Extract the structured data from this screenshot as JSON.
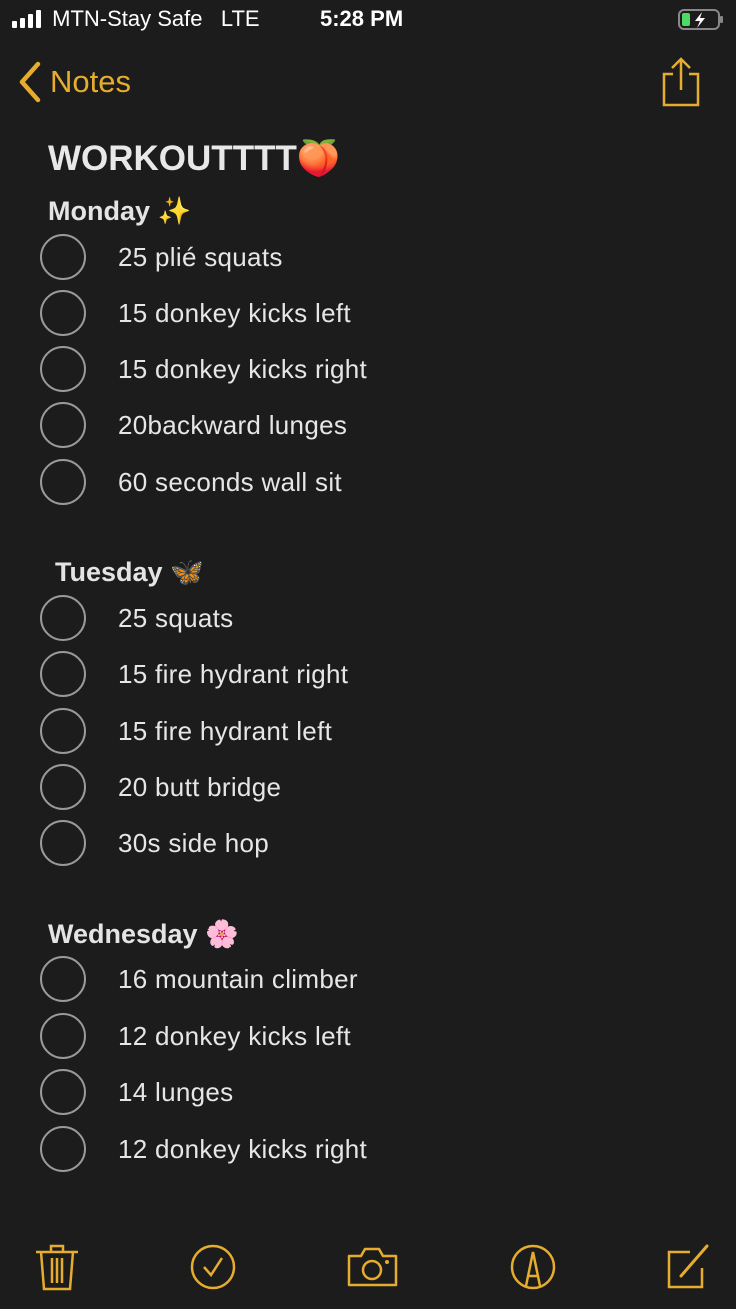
{
  "status_bar": {
    "carrier": "MTN-Stay Safe",
    "network": "LTE",
    "time": "5:28 PM",
    "battery": "charging"
  },
  "nav": {
    "back_label": "Notes"
  },
  "note": {
    "title": "WORKOUTTTT",
    "title_emoji": "🍑",
    "sections": [
      {
        "day": "Monday",
        "emoji": "✨",
        "items": [
          {
            "text": "25 plié squats",
            "checked": false
          },
          {
            "text": "15 donkey kicks left",
            "checked": false
          },
          {
            "text": "15 donkey kicks right",
            "checked": false
          },
          {
            "text": "20backward lunges",
            "checked": false
          },
          {
            "text": "60 seconds wall sit",
            "checked": false
          }
        ]
      },
      {
        "day": "Tuesday",
        "emoji": "🦋",
        "items": [
          {
            "text": "25 squats",
            "checked": false
          },
          {
            "text": "15 fire hydrant right",
            "checked": false
          },
          {
            "text": "15 fire hydrant left",
            "checked": false
          },
          {
            "text": "20 butt bridge",
            "checked": false
          },
          {
            "text": "30s side hop",
            "checked": false
          }
        ]
      },
      {
        "day": "Wednesday",
        "emoji": "🌸",
        "items": [
          {
            "text": "16 mountain climber",
            "checked": false
          },
          {
            "text": "12 donkey kicks left",
            "checked": false
          },
          {
            "text": "14 lunges",
            "checked": false
          },
          {
            "text": "12 donkey kicks right",
            "checked": false
          }
        ]
      }
    ]
  },
  "toolbar": [
    "trash-icon",
    "checklist-icon",
    "camera-icon",
    "markup-icon",
    "compose-icon"
  ],
  "colors": {
    "accent": "#e6ac2d",
    "background": "#1c1c1d"
  }
}
